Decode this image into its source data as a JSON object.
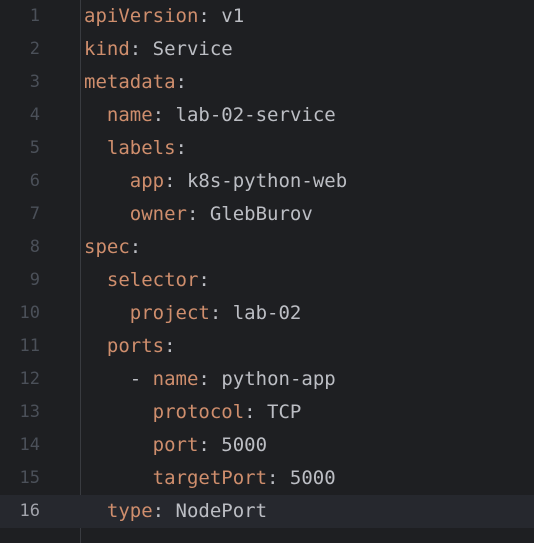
{
  "editor": {
    "current_line": 16,
    "lines": [
      {
        "num": "1",
        "indent": "",
        "dash": "",
        "key": "apiVersion",
        "colon": ":",
        "value": " v1"
      },
      {
        "num": "2",
        "indent": "",
        "dash": "",
        "key": "kind",
        "colon": ":",
        "value": " Service"
      },
      {
        "num": "3",
        "indent": "",
        "dash": "",
        "key": "metadata",
        "colon": ":",
        "value": ""
      },
      {
        "num": "4",
        "indent": "  ",
        "dash": "",
        "key": "name",
        "colon": ":",
        "value": " lab-02-service"
      },
      {
        "num": "5",
        "indent": "  ",
        "dash": "",
        "key": "labels",
        "colon": ":",
        "value": ""
      },
      {
        "num": "6",
        "indent": "    ",
        "dash": "",
        "key": "app",
        "colon": ":",
        "value": " k8s-python-web"
      },
      {
        "num": "7",
        "indent": "    ",
        "dash": "",
        "key": "owner",
        "colon": ":",
        "value": " GlebBurov"
      },
      {
        "num": "8",
        "indent": "",
        "dash": "",
        "key": "spec",
        "colon": ":",
        "value": ""
      },
      {
        "num": "9",
        "indent": "  ",
        "dash": "",
        "key": "selector",
        "colon": ":",
        "value": ""
      },
      {
        "num": "10",
        "indent": "    ",
        "dash": "",
        "key": "project",
        "colon": ":",
        "value": " lab-02"
      },
      {
        "num": "11",
        "indent": "  ",
        "dash": "",
        "key": "ports",
        "colon": ":",
        "value": ""
      },
      {
        "num": "12",
        "indent": "    ",
        "dash": "- ",
        "key": "name",
        "colon": ":",
        "value": " python-app"
      },
      {
        "num": "13",
        "indent": "      ",
        "dash": "",
        "key": "protocol",
        "colon": ":",
        "value": " TCP"
      },
      {
        "num": "14",
        "indent": "      ",
        "dash": "",
        "key": "port",
        "colon": ":",
        "value": " 5000"
      },
      {
        "num": "15",
        "indent": "      ",
        "dash": "",
        "key": "targetPort",
        "colon": ":",
        "value": " 5000"
      },
      {
        "num": "16",
        "indent": "  ",
        "dash": "",
        "key": "type",
        "colon": ":",
        "value": " NodePort"
      }
    ]
  },
  "colors": {
    "background": "#1e1f22",
    "key": "#cf8e6d",
    "text": "#bcbec4",
    "line_number": "#4b5059",
    "current_line_bg": "#26282e"
  }
}
